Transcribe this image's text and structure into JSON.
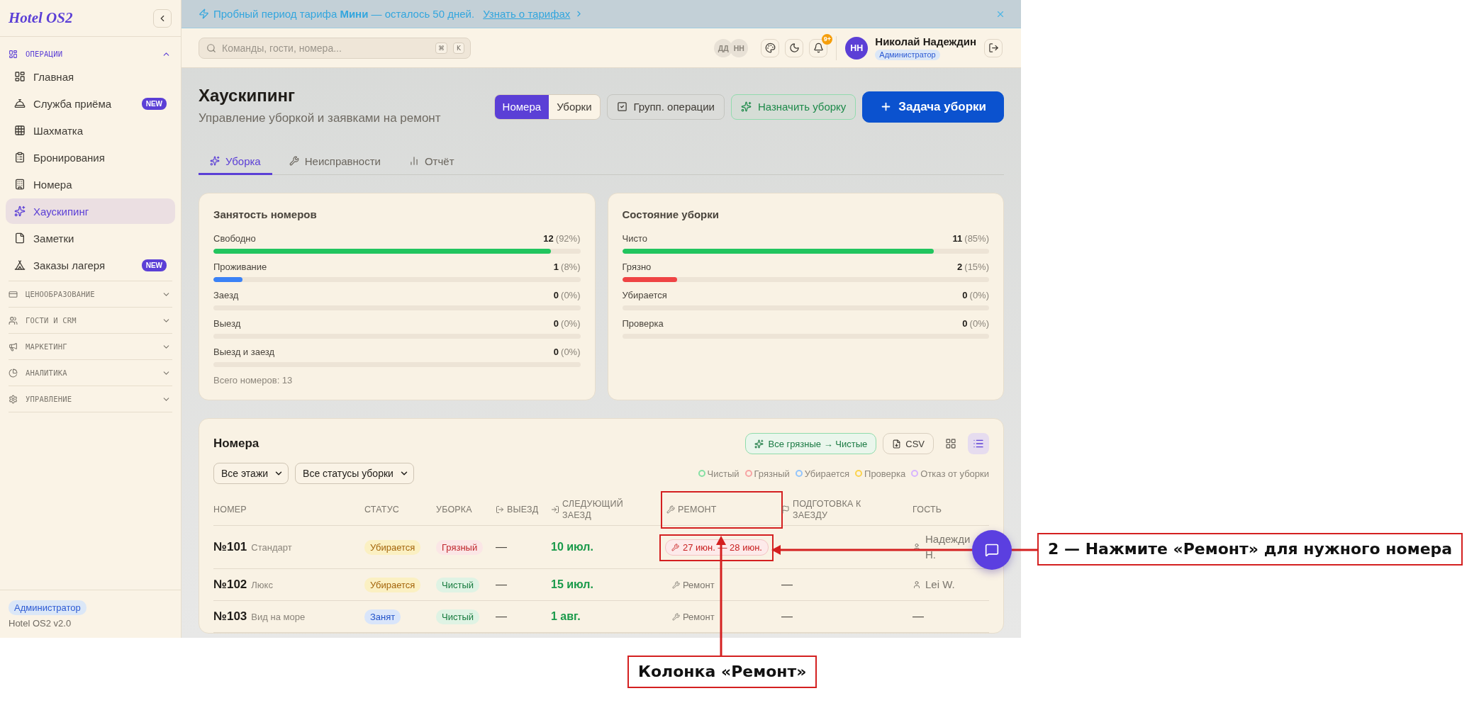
{
  "sidebar": {
    "logo": "Hotel OS2",
    "sections": [
      {
        "label": "ОПЕРАЦИИ",
        "expanded": true,
        "items": [
          {
            "label": "Главная",
            "selected": false
          },
          {
            "label": "Служба приёма",
            "selected": false,
            "badge": "NEW"
          },
          {
            "label": "Шахматка",
            "selected": false
          },
          {
            "label": "Бронирования",
            "selected": false
          },
          {
            "label": "Номера",
            "selected": false
          },
          {
            "label": "Хаускипинг",
            "selected": true
          },
          {
            "label": "Заметки",
            "selected": false
          },
          {
            "label": "Заказы лагеря",
            "selected": false,
            "badge": "NEW"
          }
        ]
      },
      {
        "label": "ЦЕНООБРАЗОВАНИЕ",
        "expanded": false
      },
      {
        "label": "ГОСТИ И CRM",
        "expanded": false
      },
      {
        "label": "МАРКЕТИНГ",
        "expanded": false
      },
      {
        "label": "АНАЛИТИКА",
        "expanded": false
      },
      {
        "label": "УПРАВЛЕНИЕ",
        "expanded": false
      }
    ],
    "footer": {
      "role": "Администратор",
      "version": "Hotel OS2 v2.0"
    }
  },
  "banner": {
    "text": "Пробный период тарифа **Мини** — осталось 50 дней.",
    "link": "Узнать о тарифах"
  },
  "topbar": {
    "search": {
      "placeholder": "Команды, гости, номера...",
      "keys": [
        "⌘",
        "K"
      ]
    },
    "presence": [
      "ДД",
      "НН"
    ],
    "notifications": "9+",
    "user": {
      "initials": "НН",
      "name": "Николай Надеждин",
      "role": "Администратор"
    }
  },
  "page": {
    "title": "Хаускипинг",
    "subtitle": "Управление уборкой и заявками на ремонт",
    "view_toggle": [
      {
        "label": "Номера",
        "selected": true
      },
      {
        "label": "Уборки",
        "selected": false
      }
    ],
    "actions": [
      {
        "label": "Групп. операции",
        "kind": "outline"
      },
      {
        "label": "Назначить уборку",
        "kind": "success"
      },
      {
        "label": "Задача уборки",
        "kind": "primary"
      }
    ],
    "tabs": [
      {
        "label": "Уборка",
        "selected": true
      },
      {
        "label": "Неисправности",
        "selected": false
      },
      {
        "label": "Отчёт",
        "selected": false
      }
    ]
  },
  "stats": [
    {
      "title": "Занятость номеров",
      "rows": [
        {
          "label": "Свободно",
          "count": "12",
          "percent": "(92%)",
          "level": 0.92,
          "color": "#22c55e"
        },
        {
          "label": "Проживание",
          "count": "1",
          "percent": "(8%)",
          "level": 0.08,
          "color": "#3b82f6"
        },
        {
          "label": "Заезд",
          "count": "0",
          "percent": "(0%)"
        },
        {
          "label": "Выезд",
          "count": "0",
          "percent": "(0%)"
        },
        {
          "label": "Выезд и заезд",
          "count": "0",
          "percent": "(0%)"
        }
      ],
      "total": "Всего номеров: 13"
    },
    {
      "title": "Состояние уборки",
      "rows": [
        {
          "label": "Чисто",
          "count": "11",
          "percent": "(85%)",
          "level": 0.85,
          "color": "#22c55e"
        },
        {
          "label": "Грязно",
          "count": "2",
          "percent": "(15%)",
          "level": 0.15,
          "color": "#ef4444"
        },
        {
          "label": "Убирается",
          "count": "0",
          "percent": "(0%)"
        },
        {
          "label": "Проверка",
          "count": "0",
          "percent": "(0%)"
        }
      ]
    }
  ],
  "rooms": {
    "title": "Номера",
    "bulk_action": "Все грязные → Чистые",
    "export": "CSV",
    "view_modes": [
      {
        "kind": "grid",
        "selected": false
      },
      {
        "kind": "list",
        "selected": true
      }
    ],
    "filters": [
      "Все этажи",
      "Все статусы уборки"
    ],
    "legend": [
      {
        "label": "Чистый",
        "color": "#86e0a4"
      },
      {
        "label": "Грязный",
        "color": "#f7a4a4"
      },
      {
        "label": "Убирается",
        "color": "#93c5fd"
      },
      {
        "label": "Проверка",
        "color": "#fcd34d"
      },
      {
        "label": "Отказ от уборки",
        "color": "#d8b4fe"
      }
    ],
    "columns": [
      {
        "label": "НОМЕР",
        "kind": "plain",
        "highlighted": false
      },
      {
        "label": "СТАТУС",
        "kind": "plain",
        "highlighted": false
      },
      {
        "label": "УБОРКА",
        "kind": "plain",
        "highlighted": false
      },
      {
        "label": "ВЫЕЗД",
        "kind": "checkout",
        "highlighted": false
      },
      {
        "label": "СЛЕДУЮЩИЙ ЗАЕЗД",
        "kind": "checkin",
        "highlighted": false
      },
      {
        "label": "РЕМОНТ",
        "kind": "repair",
        "highlighted": true
      },
      {
        "label": "ПОДГОТОВКА К ЗАЕЗДУ",
        "kind": "prep",
        "highlighted": false
      },
      {
        "label": "ГОСТЬ",
        "kind": "plain",
        "highlighted": false
      }
    ],
    "rows": [
      {
        "number": "№101",
        "type": "Стандарт",
        "status": {
          "label": "Убирается",
          "kind": "cleaning"
        },
        "cleaning": {
          "label": "Грязный",
          "kind": "dirty"
        },
        "checkout": "—",
        "next_arrival": "10 июл.",
        "repair": {
          "kind": "period",
          "label": "27 июн. — 28 июн.",
          "highlighted": true
        },
        "guest": {
          "kind": "person",
          "name": "Надежди Н."
        }
      },
      {
        "number": "№102",
        "type": "Люкс",
        "status": {
          "label": "Убирается",
          "kind": "cleaning"
        },
        "cleaning": {
          "label": "Чистый",
          "kind": "clean"
        },
        "checkout": "—",
        "next_arrival": "15 июл.",
        "repair": {
          "kind": "action",
          "label": "Ремонт",
          "highlighted": false
        },
        "prep": "—",
        "guest": {
          "kind": "person",
          "name": "Lei W."
        }
      },
      {
        "number": "№103",
        "type": "Вид на море",
        "status": {
          "label": "Занят",
          "kind": "occupied"
        },
        "cleaning": {
          "label": "Чистый",
          "kind": "clean"
        },
        "checkout": "—",
        "next_arrival": "1 авг.",
        "repair": {
          "kind": "action",
          "label": "Ремонт",
          "highlighted": false
        },
        "prep": "—",
        "guest": {
          "kind": "none",
          "name": "—"
        }
      }
    ]
  },
  "annotations": [
    {
      "kind": "row",
      "text": "2 — Нажмите «Ремонт» для нужного номера"
    },
    {
      "kind": "column",
      "text": "Колонка «Ремонт»"
    }
  ]
}
